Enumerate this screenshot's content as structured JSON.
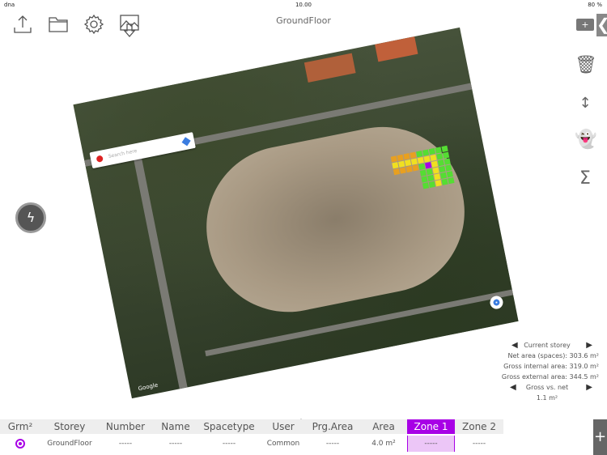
{
  "status": {
    "carrier": "dna",
    "time": "10.00",
    "battery": "80 %"
  },
  "toolbar": {
    "icons": [
      "upload-icon",
      "folder-icon",
      "gear-icon",
      "image-import-icon"
    ]
  },
  "header": {
    "title": "GroundFloor",
    "add_label": "+",
    "collapse_label": "❮"
  },
  "right_tools": [
    "trash-icon",
    "move-vertical-icon",
    "ghost-icon",
    "sigma-icon"
  ],
  "map": {
    "search_placeholder": "Search here",
    "google_label": "Google"
  },
  "stats": {
    "current_storey": "Current storey",
    "net_area": "Net area (spaces):  303.6 m²",
    "gross_internal": "Gross internal area:  319.0 m²",
    "gross_external": "Gross external area:  344.5 m²",
    "gross_vs_net": "Gross vs. net",
    "gross_vs_net_value": "1.1 m²"
  },
  "table": {
    "headers": [
      "Grm²",
      "Storey",
      "Number",
      "Name",
      "Spacetype",
      "User",
      "Prg.Area",
      "Area",
      "Zone 1",
      "Zone 2"
    ],
    "row": [
      "",
      "GroundFloor",
      "-----",
      "-----",
      "-----",
      "Common",
      "-----",
      "4.0 m²",
      "-----",
      "-----"
    ]
  },
  "colors": {
    "accent": "#a800e6",
    "zone_orange": "#e8a020",
    "zone_green": "#55dd33",
    "zone_yellow": "#f0e020"
  }
}
